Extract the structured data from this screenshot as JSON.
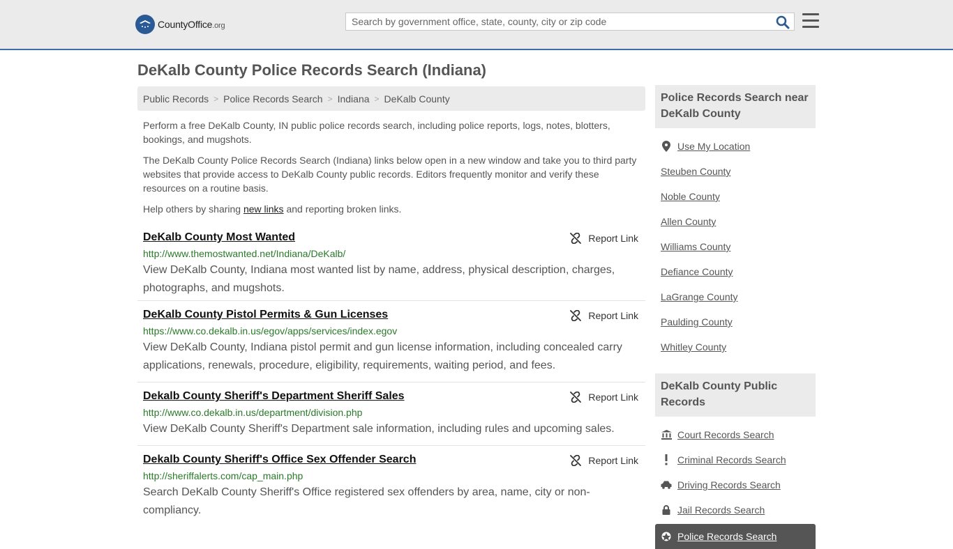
{
  "header": {
    "logo_name": "CountyOffice",
    "logo_suffix": ".org",
    "search_placeholder": "Search by government office, state, county, city or zip code"
  },
  "page_title": "DeKalb County Police Records Search (Indiana)",
  "breadcrumb": [
    "Public Records",
    "Police Records Search",
    "Indiana",
    "DeKalb County"
  ],
  "intro": {
    "p1": "Perform a free DeKalb County, IN public police records search, including police reports, logs, notes, blotters, bookings, and mugshots.",
    "p2": "The DeKalb County Police Records Search (Indiana) links below open in a new window and take you to third party websites that provide access to DeKalb County public records. Editors frequently monitor and verify these resources on a routine basis.",
    "p3_before": "Help others by sharing ",
    "p3_link": "new links",
    "p3_after": " and reporting broken links."
  },
  "report_label": "Report Link",
  "results": [
    {
      "title": "DeKalb County Most Wanted",
      "url": "http://www.themostwanted.net/Indiana/DeKalb/",
      "desc": "View DeKalb County, Indiana most wanted list by name, address, physical description, charges, photographs, and mugshots."
    },
    {
      "title": "DeKalb County Pistol Permits & Gun Licenses",
      "url": "https://www.co.dekalb.in.us/egov/apps/services/index.egov",
      "desc": "View DeKalb County, Indiana pistol permit and gun license information, including concealed carry applications, renewals, procedure, eligibility, requirements, waiting period, and fees."
    },
    {
      "title": "Dekalb County Sheriff's Department Sheriff Sales",
      "url": "http://www.co.dekalb.in.us/department/division.php",
      "desc": "View DeKalb County Sheriff's Department sale information, including rules and upcoming sales."
    },
    {
      "title": "Dekalb County Sheriff's Office Sex Offender Search",
      "url": "http://sheriffalerts.com/cap_main.php",
      "desc": "Search DeKalb County Sheriff's Office registered sex offenders by area, name, city or non-compliancy."
    }
  ],
  "sidebar": {
    "nearby_title": "Police Records Search near DeKalb County",
    "use_location": "Use My Location",
    "nearby": [
      "Steuben County",
      "Noble County",
      "Allen County",
      "Williams County",
      "Defiance County",
      "LaGrange County",
      "Paulding County",
      "Whitley County"
    ],
    "public_title": "DeKalb County Public Records",
    "public_links": [
      {
        "label": "Court Records Search",
        "icon": "courthouse-icon"
      },
      {
        "label": "Criminal Records Search",
        "icon": "exclamation-icon"
      },
      {
        "label": "Driving Records Search",
        "icon": "car-icon"
      },
      {
        "label": "Jail Records Search",
        "icon": "lock-icon"
      }
    ],
    "active_link": "Police Records Search"
  }
}
